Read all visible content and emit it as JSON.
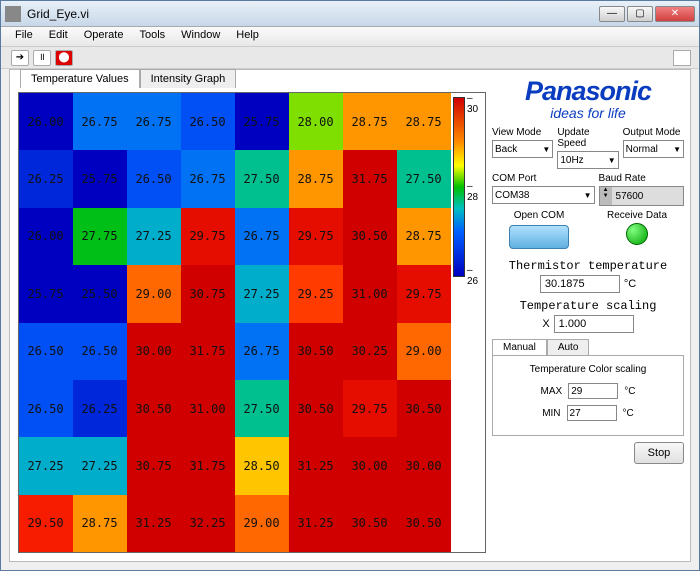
{
  "window": {
    "title": "Grid_Eye.vi"
  },
  "menu": [
    "File",
    "Edit",
    "Operate",
    "Tools",
    "Window",
    "Help"
  ],
  "tabs": {
    "active": "Temperature Values",
    "other": "Intensity Graph"
  },
  "colorbar": {
    "top": "30",
    "mid": "28",
    "bot": "26"
  },
  "grid": [
    [
      26.0,
      26.75,
      26.75,
      26.5,
      25.75,
      28.0,
      28.75,
      28.75
    ],
    [
      26.25,
      25.75,
      26.5,
      26.75,
      27.5,
      28.75,
      31.75,
      27.5
    ],
    [
      26.0,
      27.75,
      27.25,
      29.75,
      26.75,
      29.75,
      30.5,
      28.75
    ],
    [
      25.75,
      25.5,
      29.0,
      30.75,
      27.25,
      29.25,
      31.0,
      29.75
    ],
    [
      26.5,
      26.5,
      30.0,
      31.75,
      26.75,
      30.5,
      30.25,
      29.0
    ],
    [
      26.5,
      26.25,
      30.5,
      31.0,
      27.5,
      30.5,
      29.75,
      30.5
    ],
    [
      27.25,
      27.25,
      30.75,
      31.75,
      28.5,
      31.25,
      30.0,
      30.0
    ],
    [
      29.5,
      28.75,
      31.25,
      32.25,
      29.0,
      31.25,
      30.5,
      30.5
    ]
  ],
  "brand": {
    "name": "Panasonic",
    "tagline": "ideas for life"
  },
  "controls": {
    "view_mode_label": "View Mode",
    "view_mode": "Back",
    "update_speed_label": "Update Speed",
    "update_speed": "10Hz",
    "output_mode_label": "Output Mode",
    "output_mode": "Normal",
    "com_port_label": "COM Port",
    "com_port": "COM38",
    "baud_label": "Baud Rate",
    "baud": "57600",
    "open_com": "Open COM",
    "receive_data": "Receive Data"
  },
  "thermistor": {
    "title": "Thermistor temperature",
    "value": "30.1875",
    "unit": "°C"
  },
  "scaling": {
    "title": "Temperature scaling",
    "x_label": "X",
    "x_value": "1.000"
  },
  "subtabs": {
    "manual": "Manual",
    "auto": "Auto"
  },
  "colorscale": {
    "title": "Temperature Color scaling",
    "max_label": "MAX",
    "max_value": "29",
    "max_unit": "°C",
    "min_label": "MIN",
    "min_value": "27",
    "min_unit": "°C"
  },
  "stop": "Stop",
  "chart_data": {
    "type": "heatmap",
    "title": "Temperature Values",
    "rows": 8,
    "cols": 8,
    "colorscale_range": [
      26,
      30
    ],
    "values": [
      [
        26.0,
        26.75,
        26.75,
        26.5,
        25.75,
        28.0,
        28.75,
        28.75
      ],
      [
        26.25,
        25.75,
        26.5,
        26.75,
        27.5,
        28.75,
        31.75,
        27.5
      ],
      [
        26.0,
        27.75,
        27.25,
        29.75,
        26.75,
        29.75,
        30.5,
        28.75
      ],
      [
        25.75,
        25.5,
        29.0,
        30.75,
        27.25,
        29.25,
        31.0,
        29.75
      ],
      [
        26.5,
        26.5,
        30.0,
        31.75,
        26.75,
        30.5,
        30.25,
        29.0
      ],
      [
        26.5,
        26.25,
        30.5,
        31.0,
        27.5,
        30.5,
        29.75,
        30.5
      ],
      [
        27.25,
        27.25,
        30.75,
        31.75,
        28.5,
        31.25,
        30.0,
        30.0
      ],
      [
        29.5,
        28.75,
        31.25,
        32.25,
        29.0,
        31.25,
        30.5,
        30.5
      ]
    ]
  }
}
